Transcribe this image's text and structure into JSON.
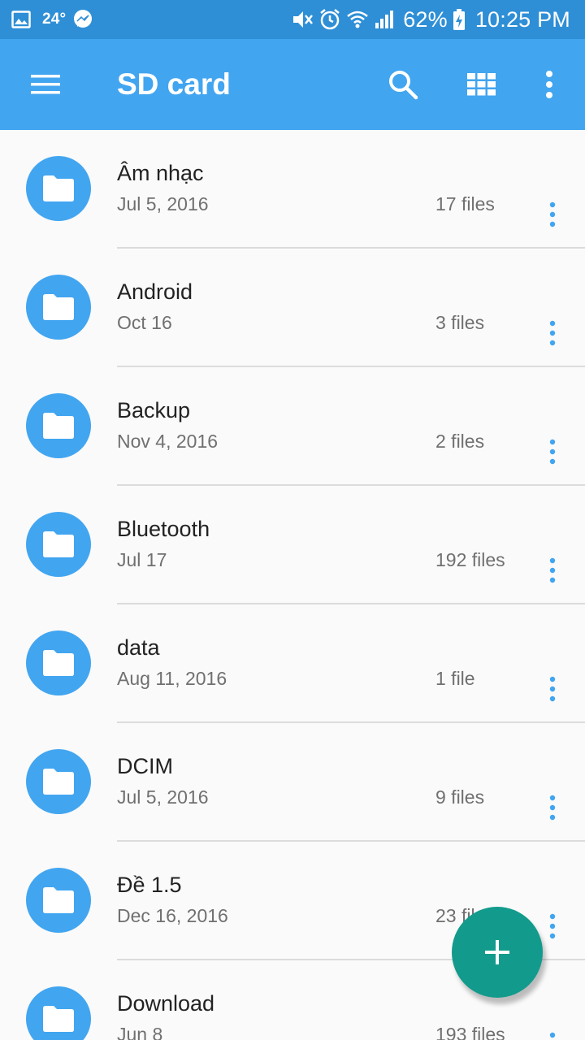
{
  "status_bar": {
    "temperature": "24°",
    "battery": "62%",
    "time": "10:25 PM",
    "icons": [
      "gallery-icon",
      "messenger-icon",
      "mute-icon",
      "alarm-icon",
      "wifi-icon",
      "signal-icon",
      "battery-charging-icon"
    ]
  },
  "app_bar": {
    "title": "SD card",
    "icons": [
      "menu-icon",
      "search-icon",
      "grid-view-icon",
      "more-vert-icon"
    ],
    "color": "#42a5f0"
  },
  "files": [
    {
      "name": "Âm nhạc",
      "date": "Jul 5, 2016",
      "count": "17 files"
    },
    {
      "name": "Android",
      "date": "Oct 16",
      "count": "3 files"
    },
    {
      "name": "Backup",
      "date": "Nov 4, 2016",
      "count": "2 files"
    },
    {
      "name": "Bluetooth",
      "date": "Jul 17",
      "count": "192 files"
    },
    {
      "name": "data",
      "date": "Aug 11, 2016",
      "count": "1 file"
    },
    {
      "name": "DCIM",
      "date": "Jul 5, 2016",
      "count": "9 files"
    },
    {
      "name": "Đề 1.5",
      "date": "Dec 16, 2016",
      "count": "23 files"
    },
    {
      "name": "Download",
      "date": "Jun 8",
      "count": "193 files"
    }
  ],
  "fab": {
    "icon": "plus-icon",
    "color": "#129b8c"
  }
}
